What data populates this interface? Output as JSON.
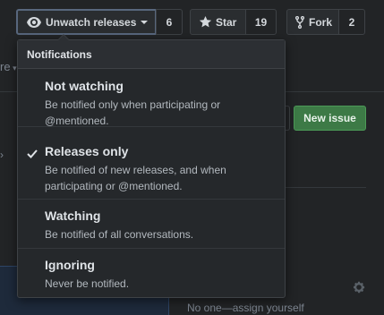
{
  "header": {
    "watch": {
      "label": "Unwatch releases",
      "count": "6"
    },
    "star": {
      "label": "Star",
      "count": "19"
    },
    "fork": {
      "label": "Fork",
      "count": "2"
    }
  },
  "background": {
    "fragment_left": "re",
    "new_issue_label": "New issue",
    "assignee_text": "No one—assign yourself"
  },
  "menu": {
    "title": "Notifications",
    "items": [
      {
        "title": "Not watching",
        "description": "Be notified only when participating or @mentioned.",
        "selected": false
      },
      {
        "title": "Releases only",
        "description": "Be notified of new releases, and when participating or @mentioned.",
        "selected": true
      },
      {
        "title": "Watching",
        "description": "Be notified of all conversations.",
        "selected": false
      },
      {
        "title": "Ignoring",
        "description": "Never be notified.",
        "selected": false
      }
    ]
  },
  "colors": {
    "background": "#222426",
    "menu_bg": "#25282b",
    "new_issue_green": "#3d7a46",
    "watch_focus_border": "#58677d"
  }
}
